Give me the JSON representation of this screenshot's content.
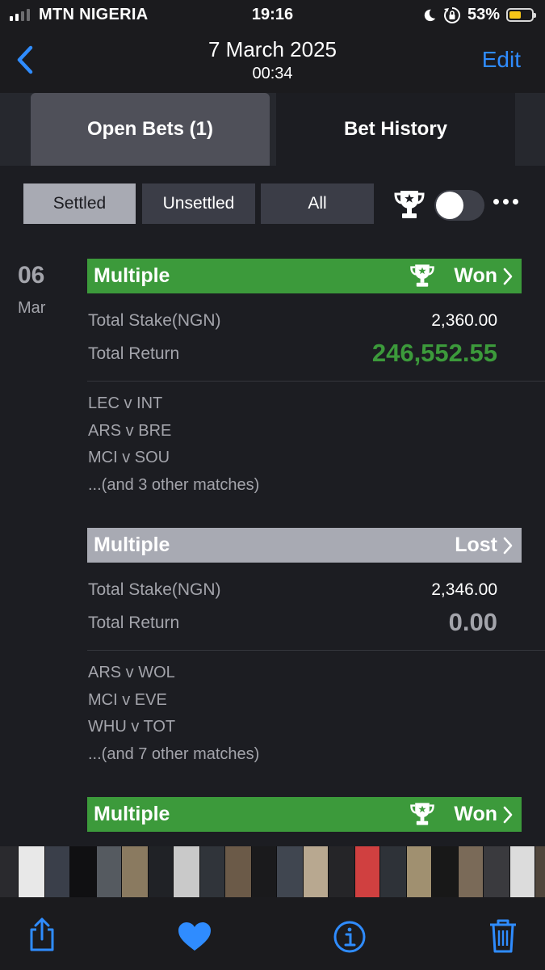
{
  "status_bar": {
    "carrier": "MTN NIGERIA",
    "time": "19:16",
    "battery_percent": "53%",
    "battery_level": 0.53,
    "signal_bars_active": 2,
    "icons": [
      "signal-icon",
      "moon-icon",
      "rotation-lock-icon",
      "battery-icon"
    ]
  },
  "nav": {
    "title": "7 March 2025",
    "subtitle": "00:34",
    "edit_label": "Edit",
    "back_icon": "chevron-left-icon"
  },
  "tabs": [
    {
      "label": "Open Bets (1)",
      "active": true
    },
    {
      "label": "Bet History",
      "active": false
    }
  ],
  "filters": {
    "settled": "Settled",
    "unsettled": "Unsettled",
    "all": "All",
    "selected": "Settled",
    "trophy_icon": "trophy-icon",
    "toggle_on": false,
    "more_icon": "ellipsis-icon"
  },
  "date": {
    "day": "06",
    "month": "Mar"
  },
  "colors": {
    "won": "#3c9a3b",
    "lost": "#a8aab3",
    "accent": "#2f8cff",
    "background": "#1c1d22"
  },
  "bets": [
    {
      "type": "Multiple",
      "result": "Won",
      "stake_label": "Total Stake(NGN)",
      "stake": "2,360.00",
      "return_label": "Total Return",
      "return": "246,552.55",
      "matches": [
        "LEC v INT",
        "ARS v BRE",
        "MCI v SOU"
      ],
      "more": "...(and 3 other matches)"
    },
    {
      "type": "Multiple",
      "result": "Lost",
      "stake_label": "Total Stake(NGN)",
      "stake": "2,346.00",
      "return_label": "Total Return",
      "return": "0.00",
      "matches": [
        "ARS v WOL",
        "MCI v EVE",
        "WHU v TOT"
      ],
      "more": "...(and 7 other matches)"
    },
    {
      "type": "Multiple",
      "result": "Won"
    }
  ],
  "toolbar": {
    "icons": [
      "share-icon",
      "heart-icon",
      "info-icon",
      "trash-icon"
    ]
  }
}
